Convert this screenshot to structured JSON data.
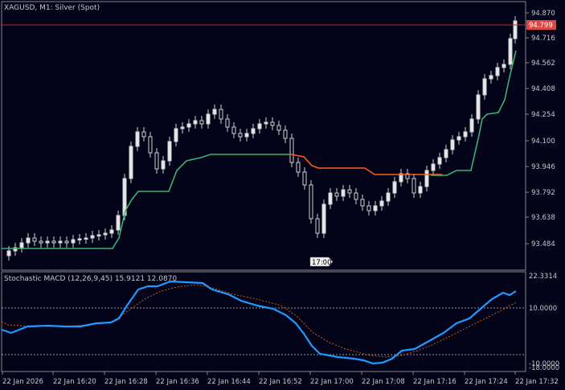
{
  "main_chart": {
    "title": "XAGUSD, M1:  Silver (Spot)",
    "price_labels": [
      "94.870",
      "94.716",
      "94.562",
      "94.408",
      "94.254",
      "94.100",
      "93.946",
      "93.792",
      "93.638",
      "93.484"
    ],
    "current_price": "94.799",
    "time_marker": "17:00"
  },
  "sub_chart": {
    "title": "Stochastic MACD (12,26,9,45) 15.9121 12.0870",
    "levels": [
      "22.3314",
      "10.0000",
      "-10.0000",
      "-18.0000"
    ]
  },
  "time_axis": [
    "22 Jan 2026",
    "22 Jan 16:20",
    "22 Jan 16:28",
    "22 Jan 16:36",
    "22 Jan 16:44",
    "22 Jan 16:52",
    "22 Jan 17:00",
    "22 Jan 17:08",
    "22 Jan 17:16",
    "22 Jan 17:24",
    "22 Jan 17:32"
  ],
  "colors": {
    "background": "#03031a",
    "axis": "#8a8a8a",
    "text": "#c9c9c9",
    "candle": "#d0d0d0",
    "trail_up": "#3cb371",
    "trail_down": "#ff5a1f",
    "bid_line": "#b03030",
    "price_tag": "#e04545",
    "macd_main": "#1e9bff",
    "macd_signal": "#d2691e"
  }
}
